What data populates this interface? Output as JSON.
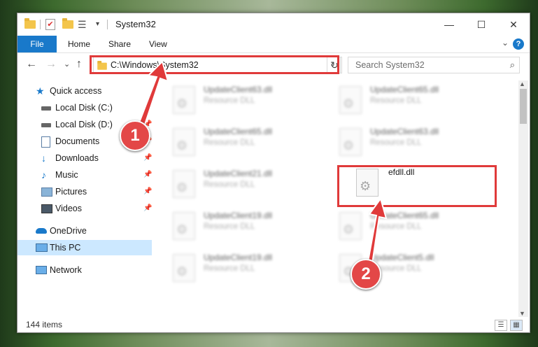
{
  "window": {
    "title": "System32",
    "controls": {
      "minimize": "—",
      "maximize": "☐",
      "close": "✕"
    }
  },
  "ribbon": {
    "tabs": [
      "File",
      "Home",
      "Share",
      "View"
    ],
    "help": "?",
    "expand": "⌄"
  },
  "navigation": {
    "back": "←",
    "forward": "→",
    "recent": "⌄",
    "up": "↑",
    "address": "C:\\Windows\\System32",
    "address_dropdown": "⌄",
    "refresh": "↻",
    "search_placeholder": "Search System32"
  },
  "sidebar": {
    "items": [
      {
        "label": "Quick access",
        "icon": "star-icon",
        "pinned": false
      },
      {
        "label": "Local Disk (C:)",
        "icon": "drive-icon",
        "pinned": true
      },
      {
        "label": "Local Disk (D:)",
        "icon": "drive-icon",
        "pinned": true
      },
      {
        "label": "Documents",
        "icon": "documents-icon",
        "pinned": true
      },
      {
        "label": "Downloads",
        "icon": "download-icon",
        "pinned": true
      },
      {
        "label": "Music",
        "icon": "music-icon",
        "pinned": true
      },
      {
        "label": "Pictures",
        "icon": "pictures-icon",
        "pinned": true
      },
      {
        "label": "Videos",
        "icon": "videos-icon",
        "pinned": true
      },
      {
        "label": "OneDrive",
        "icon": "cloud-icon",
        "pinned": false
      },
      {
        "label": "This PC",
        "icon": "computer-icon",
        "pinned": false,
        "selected": true
      },
      {
        "label": "Network",
        "icon": "network-icon",
        "pinned": false
      }
    ],
    "pin_glyph": "📌"
  },
  "files": [
    {
      "name": "UpdateClient63.dll",
      "type": "Resource DLL",
      "blurred": true
    },
    {
      "name": "UpdateClient65.dll",
      "type": "Resource DLL",
      "blurred": true
    },
    {
      "name": "UpdateClient65.dll",
      "type": "Resource DLL",
      "blurred": true
    },
    {
      "name": "UpdateClient63.dll",
      "type": "Resource DLL",
      "blurred": true
    },
    {
      "name": "UpdateClient21.dll",
      "type": "Resource DLL",
      "blurred": true
    },
    {
      "name": "efdll.dll",
      "type": "",
      "blurred": false
    },
    {
      "name": "UpdateClient19.dll",
      "type": "Resource DLL",
      "blurred": true
    },
    {
      "name": "UpdateClient65.dll",
      "type": "Resource DLL",
      "blurred": true
    },
    {
      "name": "UpdateClient19.dll",
      "type": "Resource DLL",
      "blurred": true
    },
    {
      "name": "UpdateClient5.dll",
      "type": "Resource DLL",
      "blurred": true
    }
  ],
  "status": {
    "item_count": "144 items"
  },
  "annotations": {
    "step1": "1",
    "step2": "2",
    "highlight_color": "#e03a3a"
  }
}
